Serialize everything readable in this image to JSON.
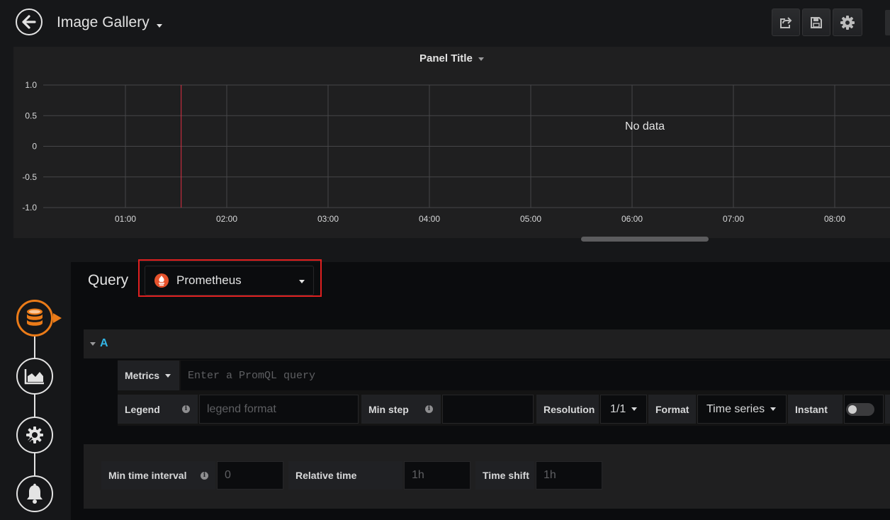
{
  "nav": {
    "dashboard_title": "Image Gallery"
  },
  "panel": {
    "title": "Panel Title",
    "no_data": "No data"
  },
  "chart_data": {
    "type": "line",
    "title": "Panel Title",
    "y_ticks": [
      "1.0",
      "0.5",
      "0",
      "-0.5",
      "-1.0"
    ],
    "x_ticks": [
      "01:00",
      "02:00",
      "03:00",
      "04:00",
      "05:00",
      "06:00",
      "07:00",
      "08:00"
    ],
    "ylim": [
      -1.0,
      1.0
    ],
    "series": [],
    "annotations": [
      "No data"
    ],
    "grid": true,
    "marker_color": "#e02f44"
  },
  "editor": {
    "query_label": "Query",
    "datasource": {
      "name": "Prometheus",
      "icon": "prometheus-icon",
      "icon_color": "#e6522c"
    },
    "query_row": {
      "ref_id": "A",
      "metrics_label": "Metrics",
      "query_placeholder": "Enter a PromQL query",
      "legend_label": "Legend",
      "legend_placeholder": "legend format",
      "min_step_label": "Min step",
      "min_step_value": "",
      "resolution_label": "Resolution",
      "resolution_value": "1/1",
      "format_label": "Format",
      "format_value": "Time series",
      "instant_label": "Instant",
      "instant_on": false
    },
    "options": {
      "min_interval_label": "Min time interval",
      "min_interval_placeholder": "0",
      "relative_time_label": "Relative time",
      "relative_time_placeholder": "1h",
      "time_shift_label": "Time shift",
      "time_shift_placeholder": "1h"
    }
  },
  "side_rail": {
    "items": [
      "queries-icon",
      "visualization-icon",
      "general-settings-icon",
      "alert-bell-icon"
    ],
    "active_color": "#eb7b18"
  }
}
